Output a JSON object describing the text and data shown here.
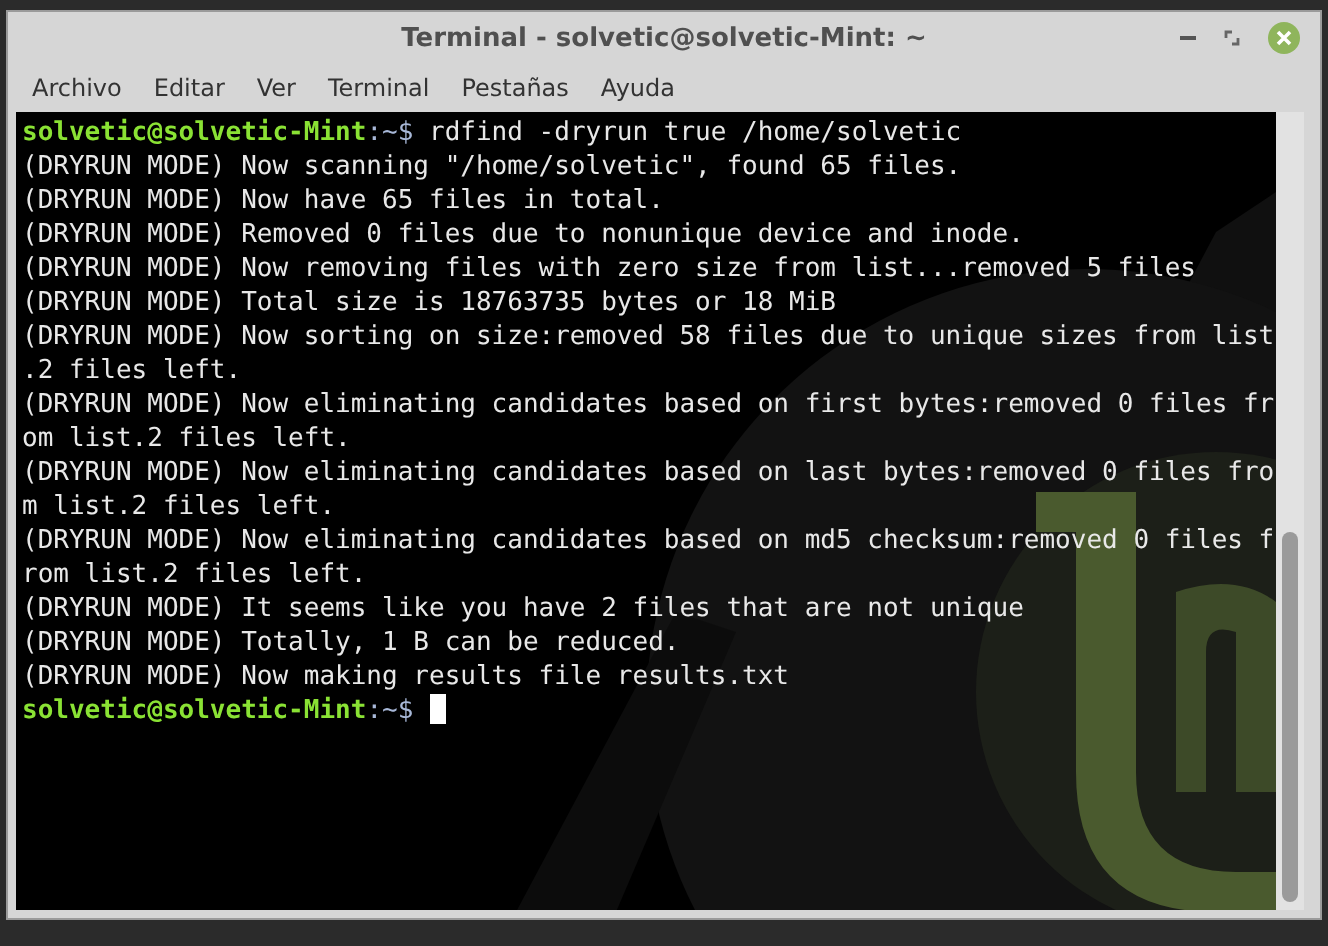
{
  "window": {
    "title": "Terminal - solvetic@solvetic-Mint: ~"
  },
  "menu": [
    "Archivo",
    "Editar",
    "Ver",
    "Terminal",
    "Pestañas",
    "Ayuda"
  ],
  "terminal": {
    "lines": [
      {
        "kind": "prompt",
        "user_host": "solvetic@solvetic-Mint",
        "path": ":~$",
        "command": " rdfind -dryrun true /home/solvetic"
      },
      {
        "kind": "output",
        "text": "(DRYRUN MODE) Now scanning \"/home/solvetic\", found 65 files."
      },
      {
        "kind": "output",
        "text": "(DRYRUN MODE) Now have 65 files in total."
      },
      {
        "kind": "output",
        "text": "(DRYRUN MODE) Removed 0 files due to nonunique device and inode."
      },
      {
        "kind": "output",
        "text": "(DRYRUN MODE) Now removing files with zero size from list...removed 5 files"
      },
      {
        "kind": "output",
        "text": "(DRYRUN MODE) Total size is 18763735 bytes or 18 MiB"
      },
      {
        "kind": "output",
        "text": "(DRYRUN MODE) Now sorting on size:removed 58 files due to unique sizes from list"
      },
      {
        "kind": "output",
        "text": ".2 files left."
      },
      {
        "kind": "output",
        "text": "(DRYRUN MODE) Now eliminating candidates based on first bytes:removed 0 files fr"
      },
      {
        "kind": "output",
        "text": "om list.2 files left."
      },
      {
        "kind": "output",
        "text": "(DRYRUN MODE) Now eliminating candidates based on last bytes:removed 0 files fro"
      },
      {
        "kind": "output",
        "text": "m list.2 files left."
      },
      {
        "kind": "output",
        "text": "(DRYRUN MODE) Now eliminating candidates based on md5 checksum:removed 0 files f"
      },
      {
        "kind": "output",
        "text": "rom list.2 files left."
      },
      {
        "kind": "output",
        "text": "(DRYRUN MODE) It seems like you have 2 files that are not unique"
      },
      {
        "kind": "output",
        "text": "(DRYRUN MODE) Totally, 1 B can be reduced."
      },
      {
        "kind": "output",
        "text": "(DRYRUN MODE) Now making results file results.txt"
      },
      {
        "kind": "prompt",
        "user_host": "solvetic@solvetic-Mint",
        "path": ":~$",
        "cursor": true
      }
    ]
  }
}
